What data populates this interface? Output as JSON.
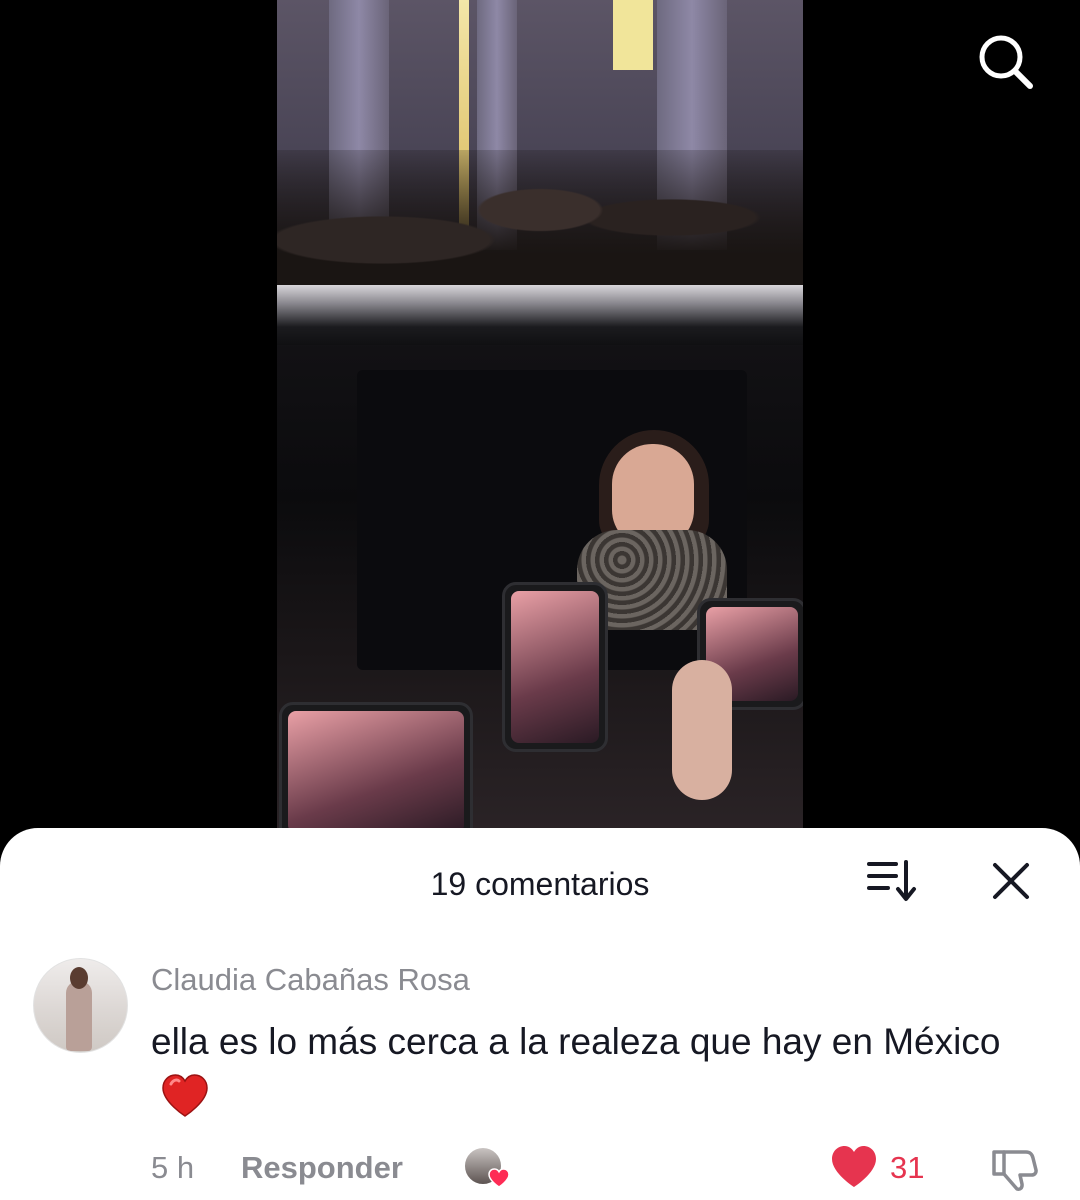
{
  "header": {
    "search_icon": "search-icon"
  },
  "comments_sheet": {
    "title": "19 comentarios",
    "sort_icon": "sort-icon",
    "close_icon": "close-icon"
  },
  "comment": {
    "username": "Claudia Cabañas Rosa",
    "text": "ella es lo más cerca a la realeza que hay en México",
    "emoji": "heart-emoji",
    "time": "5 h",
    "reply_label": "Responder",
    "liked_by_creator_icon": "creator-heart-icon",
    "like_count": "31",
    "like_color": "#e6344f",
    "dislike_icon": "thumbs-down-icon"
  }
}
